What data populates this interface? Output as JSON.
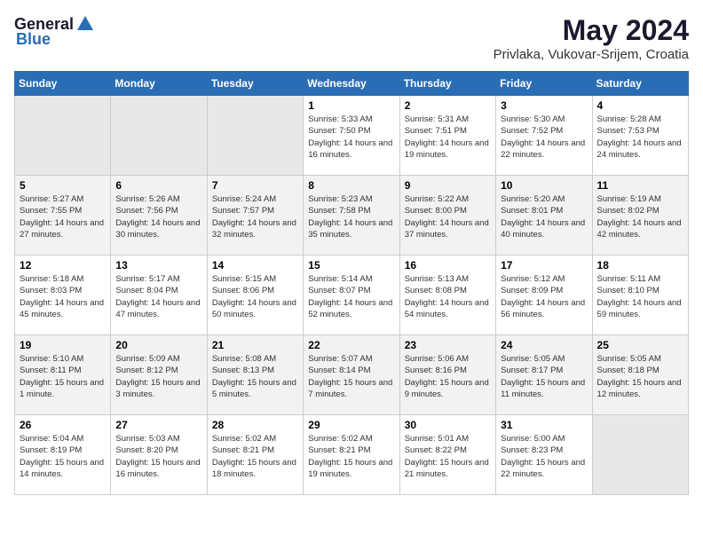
{
  "logo": {
    "general": "General",
    "blue": "Blue"
  },
  "title": "May 2024",
  "subtitle": "Privlaka, Vukovar-Srijem, Croatia",
  "weekdays": [
    "Sunday",
    "Monday",
    "Tuesday",
    "Wednesday",
    "Thursday",
    "Friday",
    "Saturday"
  ],
  "weeks": [
    [
      {
        "day": "",
        "info": ""
      },
      {
        "day": "",
        "info": ""
      },
      {
        "day": "",
        "info": ""
      },
      {
        "day": "1",
        "info": "Sunrise: 5:33 AM\nSunset: 7:50 PM\nDaylight: 14 hours and 16 minutes."
      },
      {
        "day": "2",
        "info": "Sunrise: 5:31 AM\nSunset: 7:51 PM\nDaylight: 14 hours and 19 minutes."
      },
      {
        "day": "3",
        "info": "Sunrise: 5:30 AM\nSunset: 7:52 PM\nDaylight: 14 hours and 22 minutes."
      },
      {
        "day": "4",
        "info": "Sunrise: 5:28 AM\nSunset: 7:53 PM\nDaylight: 14 hours and 24 minutes."
      }
    ],
    [
      {
        "day": "5",
        "info": "Sunrise: 5:27 AM\nSunset: 7:55 PM\nDaylight: 14 hours and 27 minutes."
      },
      {
        "day": "6",
        "info": "Sunrise: 5:26 AM\nSunset: 7:56 PM\nDaylight: 14 hours and 30 minutes."
      },
      {
        "day": "7",
        "info": "Sunrise: 5:24 AM\nSunset: 7:57 PM\nDaylight: 14 hours and 32 minutes."
      },
      {
        "day": "8",
        "info": "Sunrise: 5:23 AM\nSunset: 7:58 PM\nDaylight: 14 hours and 35 minutes."
      },
      {
        "day": "9",
        "info": "Sunrise: 5:22 AM\nSunset: 8:00 PM\nDaylight: 14 hours and 37 minutes."
      },
      {
        "day": "10",
        "info": "Sunrise: 5:20 AM\nSunset: 8:01 PM\nDaylight: 14 hours and 40 minutes."
      },
      {
        "day": "11",
        "info": "Sunrise: 5:19 AM\nSunset: 8:02 PM\nDaylight: 14 hours and 42 minutes."
      }
    ],
    [
      {
        "day": "12",
        "info": "Sunrise: 5:18 AM\nSunset: 8:03 PM\nDaylight: 14 hours and 45 minutes."
      },
      {
        "day": "13",
        "info": "Sunrise: 5:17 AM\nSunset: 8:04 PM\nDaylight: 14 hours and 47 minutes."
      },
      {
        "day": "14",
        "info": "Sunrise: 5:15 AM\nSunset: 8:06 PM\nDaylight: 14 hours and 50 minutes."
      },
      {
        "day": "15",
        "info": "Sunrise: 5:14 AM\nSunset: 8:07 PM\nDaylight: 14 hours and 52 minutes."
      },
      {
        "day": "16",
        "info": "Sunrise: 5:13 AM\nSunset: 8:08 PM\nDaylight: 14 hours and 54 minutes."
      },
      {
        "day": "17",
        "info": "Sunrise: 5:12 AM\nSunset: 8:09 PM\nDaylight: 14 hours and 56 minutes."
      },
      {
        "day": "18",
        "info": "Sunrise: 5:11 AM\nSunset: 8:10 PM\nDaylight: 14 hours and 59 minutes."
      }
    ],
    [
      {
        "day": "19",
        "info": "Sunrise: 5:10 AM\nSunset: 8:11 PM\nDaylight: 15 hours and 1 minute."
      },
      {
        "day": "20",
        "info": "Sunrise: 5:09 AM\nSunset: 8:12 PM\nDaylight: 15 hours and 3 minutes."
      },
      {
        "day": "21",
        "info": "Sunrise: 5:08 AM\nSunset: 8:13 PM\nDaylight: 15 hours and 5 minutes."
      },
      {
        "day": "22",
        "info": "Sunrise: 5:07 AM\nSunset: 8:14 PM\nDaylight: 15 hours and 7 minutes."
      },
      {
        "day": "23",
        "info": "Sunrise: 5:06 AM\nSunset: 8:16 PM\nDaylight: 15 hours and 9 minutes."
      },
      {
        "day": "24",
        "info": "Sunrise: 5:05 AM\nSunset: 8:17 PM\nDaylight: 15 hours and 11 minutes."
      },
      {
        "day": "25",
        "info": "Sunrise: 5:05 AM\nSunset: 8:18 PM\nDaylight: 15 hours and 12 minutes."
      }
    ],
    [
      {
        "day": "26",
        "info": "Sunrise: 5:04 AM\nSunset: 8:19 PM\nDaylight: 15 hours and 14 minutes."
      },
      {
        "day": "27",
        "info": "Sunrise: 5:03 AM\nSunset: 8:20 PM\nDaylight: 15 hours and 16 minutes."
      },
      {
        "day": "28",
        "info": "Sunrise: 5:02 AM\nSunset: 8:21 PM\nDaylight: 15 hours and 18 minutes."
      },
      {
        "day": "29",
        "info": "Sunrise: 5:02 AM\nSunset: 8:21 PM\nDaylight: 15 hours and 19 minutes."
      },
      {
        "day": "30",
        "info": "Sunrise: 5:01 AM\nSunset: 8:22 PM\nDaylight: 15 hours and 21 minutes."
      },
      {
        "day": "31",
        "info": "Sunrise: 5:00 AM\nSunset: 8:23 PM\nDaylight: 15 hours and 22 minutes."
      },
      {
        "day": "",
        "info": ""
      }
    ]
  ]
}
